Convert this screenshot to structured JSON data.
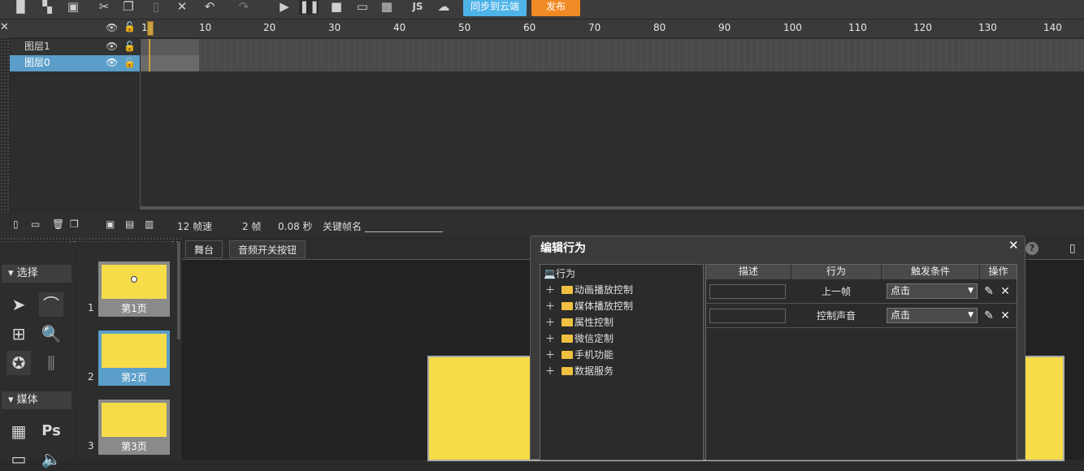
{
  "toolbar": {
    "sync_label": "同步到云端",
    "publish_label": "发布",
    "sync_color": "#4fb3e8",
    "publish_color": "#f08a24"
  },
  "timeline": {
    "ruler": [
      "1",
      "10",
      "20",
      "30",
      "40",
      "50",
      "60",
      "70",
      "80",
      "90",
      "100",
      "110",
      "120",
      "130",
      "140"
    ],
    "layers": [
      {
        "name": "图层1"
      },
      {
        "name": "图层0"
      }
    ],
    "footer": {
      "fps": "12 帧速",
      "frame": "2 帧",
      "seconds": "0.08 秒",
      "keyframe_label": "关键帧名"
    }
  },
  "toolbox": {
    "section_select": "选择",
    "section_media": "媒体",
    "ps_label": "Ps"
  },
  "pages": [
    {
      "num": "1",
      "label": "第1页"
    },
    {
      "num": "2",
      "label": "第2页"
    },
    {
      "num": "3",
      "label": "第3页"
    }
  ],
  "stage": {
    "tabs": [
      "舞台",
      "音频开关按钮"
    ]
  },
  "dialog": {
    "title": "编辑行为",
    "tree_root": "行为",
    "tree_items": [
      "动画播放控制",
      "媒体播放控制",
      "属性控制",
      "微信定制",
      "手机功能",
      "数据服务"
    ],
    "columns": [
      "描述",
      "行为",
      "触发条件",
      "操作"
    ],
    "rows": [
      {
        "action": "上一帧",
        "trigger": "点击"
      },
      {
        "action": "控制声音",
        "trigger": "点击"
      }
    ]
  }
}
